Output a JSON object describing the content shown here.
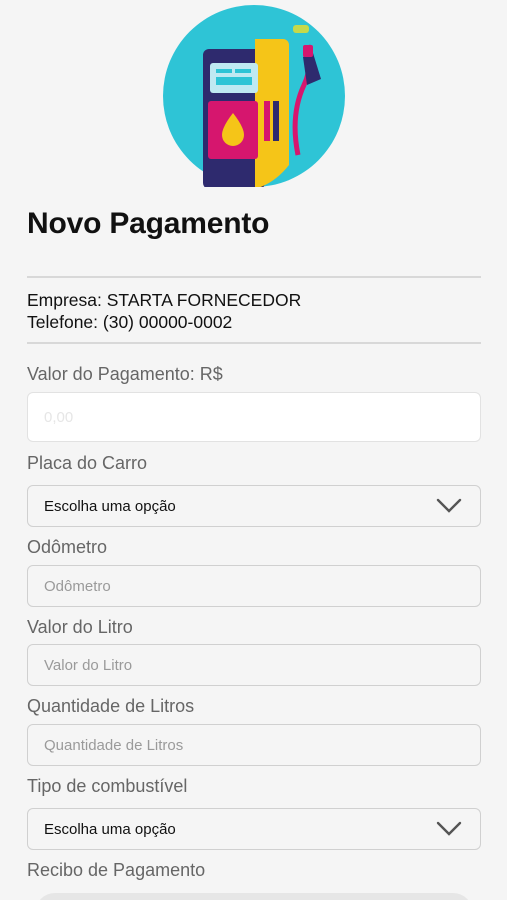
{
  "header": {
    "title": "Novo Pagamento"
  },
  "supplier": {
    "empresa": "Empresa: STARTA FORNECEDOR",
    "telefone": "Telefone: (30) 00000-0002"
  },
  "form": {
    "valor_pagamento": {
      "label": "Valor do Pagamento: R$",
      "placeholder": "0,00",
      "value": ""
    },
    "placa": {
      "label": "Placa do Carro",
      "selected": "Escolha uma opção"
    },
    "odometro": {
      "label": "Odômetro",
      "placeholder": "Odômetro"
    },
    "valor_litro": {
      "label": "Valor do Litro",
      "placeholder": "Valor do Litro"
    },
    "quantidade": {
      "label": "Quantidade de Litros",
      "placeholder": "Quantidade de Litros"
    },
    "combustivel": {
      "label": "Tipo de combustível",
      "selected": "Escolha uma opção"
    },
    "recibo": {
      "label": "Recibo de Pagamento"
    }
  },
  "colors": {
    "logo_circle": "#2ec4d6",
    "pump_body": "#2e2a6e",
    "pump_side": "#f5c518",
    "pump_panel": "#d6166e",
    "nozzle": "#d6166e"
  },
  "icons": {
    "logo": "fuel-pump-icon",
    "dropdown": "chevron-down-icon"
  }
}
